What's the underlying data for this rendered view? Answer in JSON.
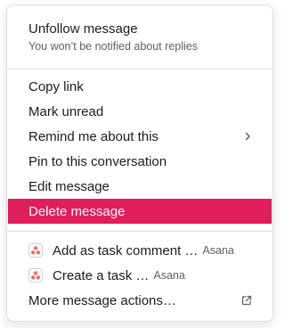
{
  "menu": {
    "unfollow": {
      "title": "Unfollow message",
      "subtitle": "You won’t be notified about replies"
    },
    "items": [
      {
        "label": "Copy link"
      },
      {
        "label": "Mark unread"
      },
      {
        "label": "Remind me about this"
      },
      {
        "label": "Pin to this conversation"
      },
      {
        "label": "Edit message"
      },
      {
        "label": "Delete message"
      }
    ],
    "actions": [
      {
        "label": "Add as task comment …",
        "app": "Asana"
      },
      {
        "label": "Create a task …",
        "app": "Asana"
      }
    ],
    "more_actions": "More message actions…"
  },
  "icons": {
    "submenu": "chevron-right-icon",
    "app": "asana-icon",
    "external": "external-link-icon"
  },
  "colors": {
    "danger": "#e01e5a",
    "asana": "#f06a6a"
  }
}
